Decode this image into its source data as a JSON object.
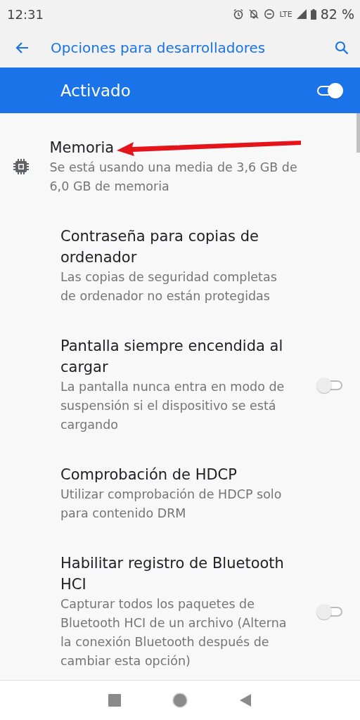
{
  "status_bar": {
    "time": "12:31",
    "network": "LTE",
    "battery": "82 %"
  },
  "app_bar": {
    "title": "Opciones para desarrolladores"
  },
  "master_switch": {
    "label": "Activado",
    "on": true
  },
  "settings": [
    {
      "kind": "icon",
      "title": "Memoria",
      "summary": "Se está usando una media de 3,6 GB de 6,0 GB de memoria",
      "annotated": true
    },
    {
      "kind": "plain",
      "title": "Contraseña para copias de ordenador",
      "summary": "Las copias de seguridad completas de ordenador no están protegidas"
    },
    {
      "kind": "switch",
      "title": "Pantalla siempre encendida al cargar",
      "summary": "La pantalla nunca entra en modo de suspensión si el dispositivo se está cargando",
      "on": false
    },
    {
      "kind": "plain",
      "title": "Comprobación de HDCP",
      "summary": "Utilizar comprobación de HDCP solo para contenido DRM"
    },
    {
      "kind": "switch",
      "title": "Habilitar registro de Bluetooth HCI",
      "summary": "Capturar todos los paquetes de Bluetooth HCI de un archivo (Alterna la conexión Bluetooth después de cambiar esta opción)",
      "on": false
    }
  ]
}
